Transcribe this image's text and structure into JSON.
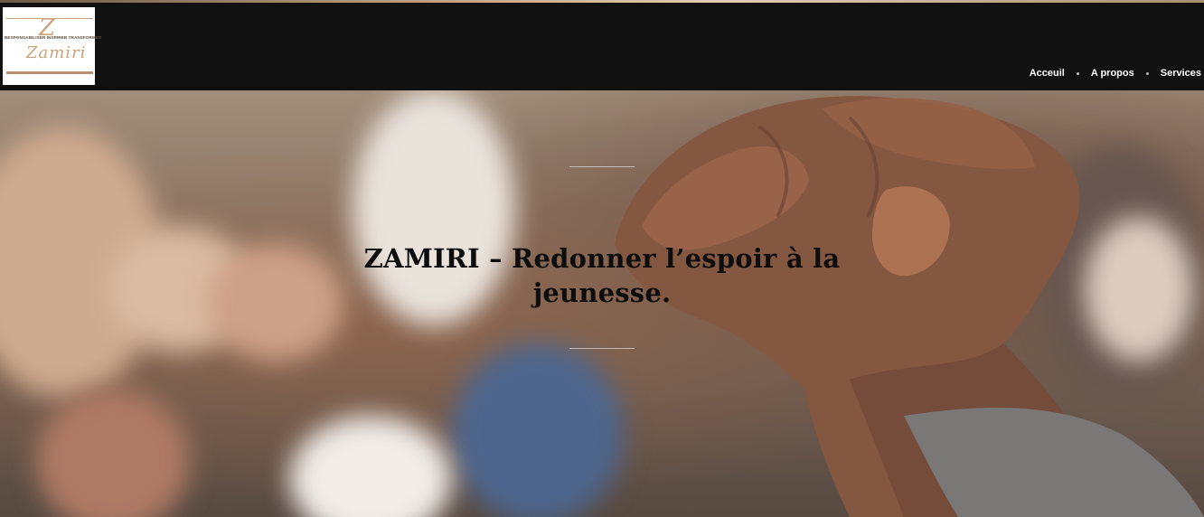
{
  "header": {
    "logo": {
      "tagline": "RESPONSABILISER INSPIRER TRANSFORMER",
      "monogram": "Z",
      "wordmark": "Zamiri"
    },
    "nav": [
      {
        "label": "Acceuil"
      },
      {
        "label": "A propos"
      },
      {
        "label": "Services"
      }
    ]
  },
  "hero": {
    "title": "ZAMIRI – Redonner l’espoir à la jeunesse."
  },
  "colors": {
    "header_bg": "#111111",
    "accent_gold": "#c8a27a",
    "nav_text": "#ffffff",
    "title_text": "#0d0d0d"
  }
}
